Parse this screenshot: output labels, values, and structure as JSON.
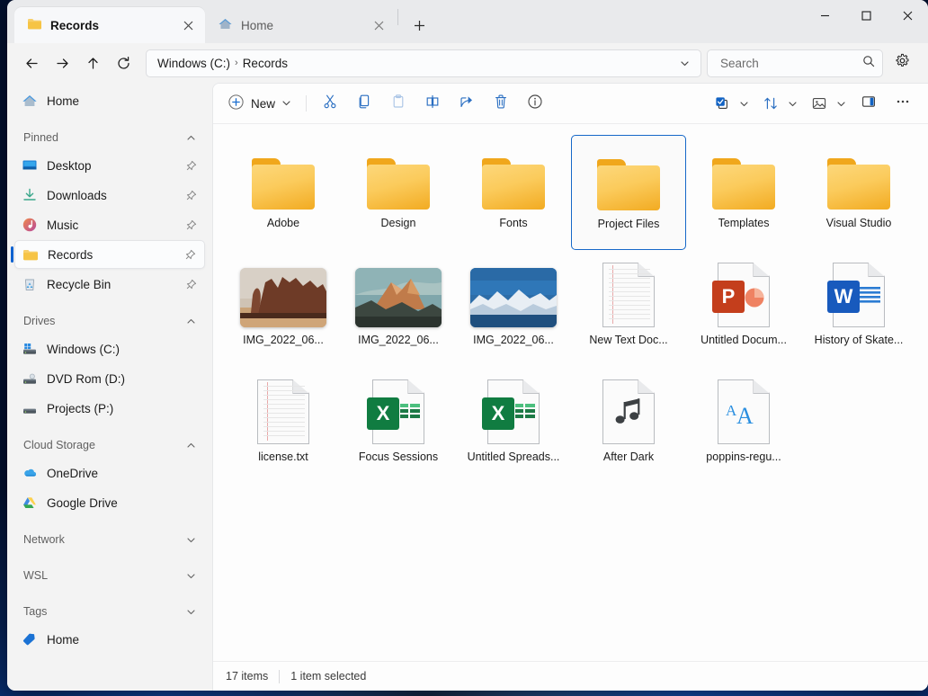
{
  "window": {
    "tabs": [
      {
        "title": "Records",
        "icon": "folder-icon",
        "active": true,
        "close": "×"
      },
      {
        "title": "Home",
        "icon": "home-icon",
        "active": false,
        "close": "×"
      }
    ],
    "new_tab_label": "+",
    "controls": {
      "minimize": "—",
      "maximize": "□",
      "close": "✕"
    }
  },
  "nav": {
    "back": "back-arrow",
    "forward": "forward-arrow",
    "up": "up-arrow",
    "refresh": "refresh",
    "breadcrumbs": [
      "Windows (C:)",
      "Records"
    ],
    "breadcrumb_separator": "›",
    "address_chevron": "chevron-down"
  },
  "search": {
    "placeholder": "Search",
    "value": ""
  },
  "settings_label": "settings",
  "sidebar": {
    "home": {
      "label": "Home",
      "icon": "home-icon"
    },
    "groups": [
      {
        "label": "Pinned",
        "expanded": true,
        "chevron": "⌃",
        "items": [
          {
            "label": "Desktop",
            "icon": "desktop-icon",
            "pinned": true,
            "selected": false
          },
          {
            "label": "Downloads",
            "icon": "downloads-icon",
            "pinned": true,
            "selected": false
          },
          {
            "label": "Music",
            "icon": "music-icon",
            "pinned": true,
            "selected": false
          },
          {
            "label": "Records",
            "icon": "folder-icon",
            "pinned": true,
            "selected": true
          },
          {
            "label": "Recycle Bin",
            "icon": "recycle-bin-icon",
            "pinned": true,
            "selected": false
          }
        ]
      },
      {
        "label": "Drives",
        "expanded": true,
        "chevron": "⌃",
        "items": [
          {
            "label": "Windows (C:)",
            "icon": "windows-drive-icon",
            "pinned": false,
            "selected": false
          },
          {
            "label": "DVD Rom (D:)",
            "icon": "dvd-drive-icon",
            "pinned": false,
            "selected": false
          },
          {
            "label": "Projects (P:)",
            "icon": "drive-icon",
            "pinned": false,
            "selected": false
          }
        ]
      },
      {
        "label": "Cloud Storage",
        "expanded": true,
        "chevron": "⌃",
        "items": [
          {
            "label": "OneDrive",
            "icon": "onedrive-icon",
            "pinned": false,
            "selected": false
          },
          {
            "label": "Google Drive",
            "icon": "google-drive-icon",
            "pinned": false,
            "selected": false
          }
        ]
      },
      {
        "label": "Network",
        "expanded": false,
        "chevron": "⌄",
        "items": []
      },
      {
        "label": "WSL",
        "expanded": false,
        "chevron": "⌄",
        "items": []
      },
      {
        "label": "Tags",
        "expanded": false,
        "chevron": "⌄",
        "items": [
          {
            "label": "Home",
            "icon": "tag-icon",
            "pinned": false,
            "selected": false
          }
        ]
      }
    ]
  },
  "toolbar": {
    "new_label": "New",
    "new_chevron": "⌄",
    "buttons": [
      {
        "name": "cut-button",
        "icon": "scissors-icon",
        "disabled": false
      },
      {
        "name": "copy-button",
        "icon": "copy-icon",
        "disabled": false
      },
      {
        "name": "paste-button",
        "icon": "paste-icon",
        "disabled": true
      },
      {
        "name": "rename-button",
        "icon": "rename-icon",
        "disabled": false
      },
      {
        "name": "share-button",
        "icon": "share-icon",
        "disabled": false
      },
      {
        "name": "delete-button",
        "icon": "trash-icon",
        "disabled": false
      },
      {
        "name": "properties-button",
        "icon": "info-icon",
        "disabled": false
      }
    ],
    "right_buttons": [
      {
        "name": "select-button",
        "icon": "select-checkbox-icon",
        "chevron": "⌄"
      },
      {
        "name": "sort-button",
        "icon": "sort-arrows-icon",
        "chevron": "⌄"
      },
      {
        "name": "view-button",
        "icon": "view-image-icon",
        "chevron": "⌄"
      },
      {
        "name": "details-pane-button",
        "icon": "details-pane-icon",
        "chevron": ""
      }
    ],
    "overflow_label": "···"
  },
  "files": [
    {
      "name": "Adobe",
      "type": "folder",
      "selected": false
    },
    {
      "name": "Design",
      "type": "folder",
      "selected": false
    },
    {
      "name": "Fonts",
      "type": "folder",
      "selected": false
    },
    {
      "name": "Project Files",
      "type": "folder",
      "selected": true
    },
    {
      "name": "Templates",
      "type": "folder",
      "selected": false
    },
    {
      "name": "Visual Studio",
      "type": "folder",
      "selected": false
    },
    {
      "name": "IMG_2022_06...",
      "type": "photo-desert",
      "selected": false
    },
    {
      "name": "IMG_2022_06...",
      "type": "photo-peak",
      "selected": false
    },
    {
      "name": "IMG_2022_06...",
      "type": "photo-snow",
      "selected": false
    },
    {
      "name": "New Text Doc...",
      "type": "text",
      "selected": false
    },
    {
      "name": "Untitled Docum...",
      "type": "powerpoint",
      "selected": false
    },
    {
      "name": "History of Skate...",
      "type": "word",
      "selected": false
    },
    {
      "name": "license.txt",
      "type": "text",
      "selected": false
    },
    {
      "name": "Focus Sessions",
      "type": "excel",
      "selected": false
    },
    {
      "name": "Untitled Spreads...",
      "type": "excel",
      "selected": false
    },
    {
      "name": "After Dark",
      "type": "music",
      "selected": false
    },
    {
      "name": "poppins-regu...",
      "type": "font",
      "selected": false
    }
  ],
  "status": {
    "item_count": "17 items",
    "selection": "1 item selected"
  },
  "colors": {
    "accent": "#0f62d0",
    "selection_border": "#1668c8",
    "folder": "#f2ab22"
  }
}
